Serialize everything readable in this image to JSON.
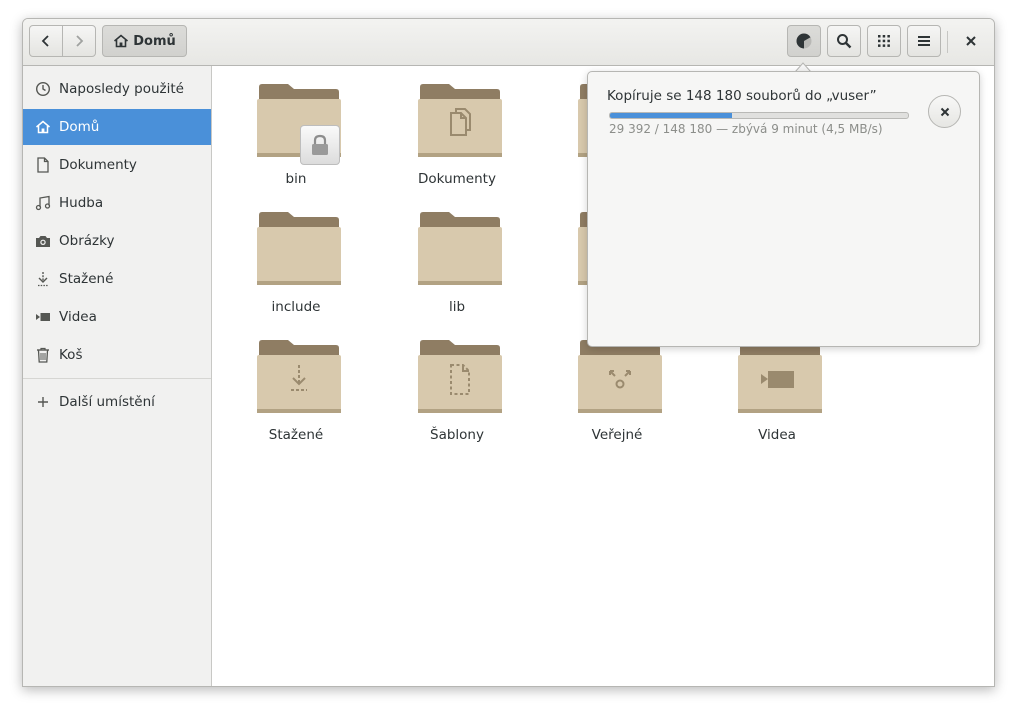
{
  "headerbar": {
    "back_icon": "chevron-left-icon",
    "forward_icon": "chevron-right-icon",
    "location_label": "Domů",
    "location_icon": "home-icon",
    "operations_icon": "pie-progress-icon",
    "search_icon": "search-icon",
    "view_icon": "grid-view-icon",
    "menu_icon": "hamburger-menu-icon",
    "close_icon": "close-icon"
  },
  "sidebar": {
    "items": [
      {
        "label": "Naposledy použité",
        "icon": "clock-icon",
        "active": false
      },
      {
        "label": "Domů",
        "icon": "home-icon",
        "active": true
      },
      {
        "label": "Dokumenty",
        "icon": "document-icon",
        "active": false
      },
      {
        "label": "Hudba",
        "icon": "music-icon",
        "active": false
      },
      {
        "label": "Obrázky",
        "icon": "camera-icon",
        "active": false
      },
      {
        "label": "Stažené",
        "icon": "download-icon",
        "active": false
      },
      {
        "label": "Videa",
        "icon": "video-icon",
        "active": false
      },
      {
        "label": "Koš",
        "icon": "trash-icon",
        "active": false
      }
    ],
    "other_locations": {
      "label": "Další umístění",
      "icon": "plus-icon"
    }
  },
  "files": [
    {
      "name": "bin",
      "emblem": "lock-icon"
    },
    {
      "name": "Dokumenty",
      "emblem": "documents-icon"
    },
    {
      "name": "",
      "emblem": ""
    },
    {
      "name": "include",
      "emblem": ""
    },
    {
      "name": "lib",
      "emblem": ""
    },
    {
      "name": "",
      "emblem": ""
    },
    {
      "name": "Stažené",
      "emblem": "download-icon"
    },
    {
      "name": "Šablony",
      "emblem": "template-icon"
    },
    {
      "name": "Veřejné",
      "emblem": "share-icon"
    },
    {
      "name": "Videa",
      "emblem": "video-icon"
    }
  ],
  "operation": {
    "title": "Kopíruje se 148 180 souborů do „vuser”",
    "detail": "29 392 / 148 180 — zbývá 9 minut (4,5 MB/s)",
    "progress": 0.41,
    "cancel_icon": "close-icon"
  },
  "colors": {
    "accent": "#4a90d9",
    "folder_body": "#d8c9ad",
    "folder_tab": "#8f7d63"
  }
}
